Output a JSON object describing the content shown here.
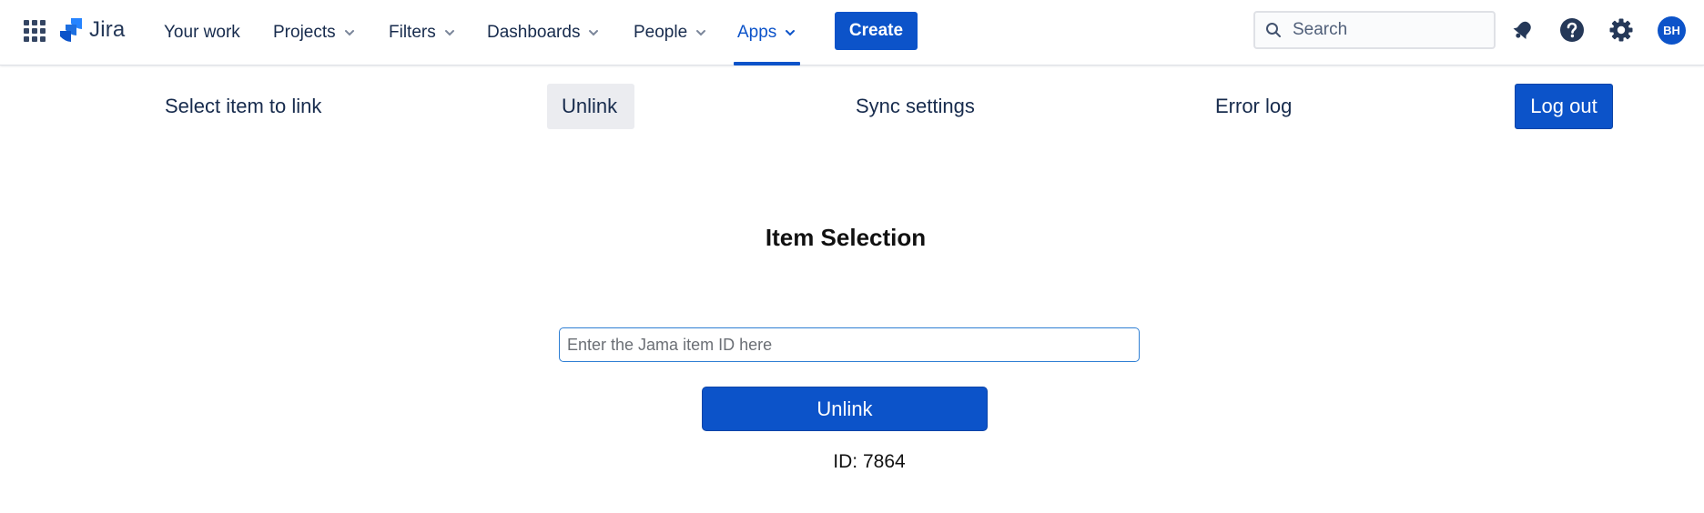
{
  "header": {
    "product_name": "Jira",
    "nav": [
      {
        "label": "Your work",
        "has_dropdown": false,
        "active": false
      },
      {
        "label": "Projects",
        "has_dropdown": true,
        "active": false
      },
      {
        "label": "Filters",
        "has_dropdown": true,
        "active": false
      },
      {
        "label": "Dashboards",
        "has_dropdown": true,
        "active": false
      },
      {
        "label": "People",
        "has_dropdown": true,
        "active": false
      },
      {
        "label": "Apps",
        "has_dropdown": true,
        "active": true
      }
    ],
    "create_label": "Create",
    "search_placeholder": "Search",
    "icons": [
      "app-switcher-icon",
      "notifications-icon",
      "help-icon",
      "settings-icon"
    ],
    "avatar_initials": "BH"
  },
  "submenu": {
    "items": [
      {
        "label": "Select item to link",
        "selected": false
      },
      {
        "label": "Unlink",
        "selected": true
      },
      {
        "label": "Sync settings",
        "selected": false
      },
      {
        "label": "Error log",
        "selected": false
      }
    ],
    "logout_label": "Log out"
  },
  "main": {
    "title": "Item Selection",
    "input_placeholder": "Enter the Jama item ID here",
    "input_value": "",
    "unlink_label": "Unlink",
    "id_text": "ID: 7864"
  },
  "colors": {
    "brand_blue": "#0c53c9",
    "text_dark": "#172b4d",
    "selected_bg": "#ebecf0"
  }
}
